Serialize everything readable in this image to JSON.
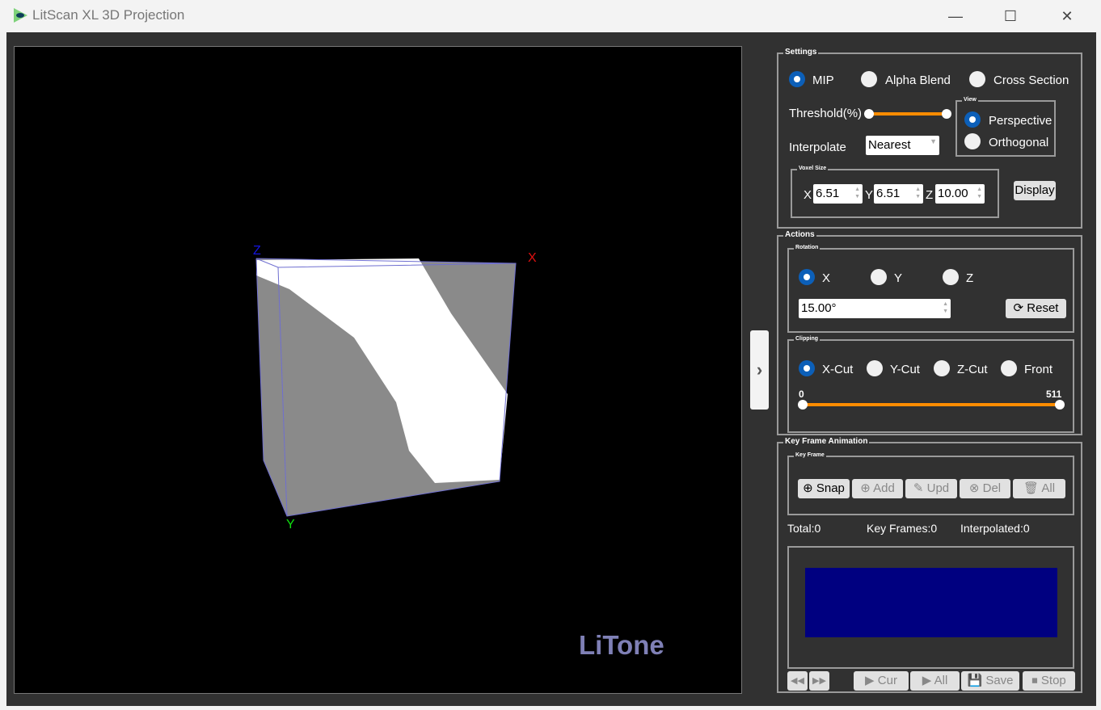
{
  "window": {
    "title": "LitScan XL 3D Projection",
    "minimize": "—",
    "maximize": "☐",
    "close": "✕"
  },
  "viewport": {
    "brand": "LiTone",
    "axes": {
      "x": "X",
      "y": "Y",
      "z": "Z"
    },
    "axis_colors": {
      "x": "#e01010",
      "y": "#10e010",
      "z": "#1010e0"
    }
  },
  "toggle_panel": "›",
  "settings": {
    "title": "Settings",
    "modes": [
      {
        "label": "MIP",
        "selected": true
      },
      {
        "label": "Alpha Blend",
        "selected": false
      },
      {
        "label": "Cross Section",
        "selected": false
      }
    ],
    "threshold_label": "Threshold(%)",
    "threshold_range": [
      0,
      100
    ],
    "interpolate_label": "Interpolate",
    "interpolate_value": "Nearest",
    "view": {
      "title": "View",
      "options": [
        {
          "label": "Perspective",
          "selected": true
        },
        {
          "label": "Orthogonal",
          "selected": false
        }
      ]
    },
    "voxel": {
      "title": "Voxel Size",
      "x_label": "X",
      "x": "6.51",
      "y_label": "Y",
      "y": "6.51",
      "z_label": "Z",
      "z": "10.00"
    },
    "display_button": "Display"
  },
  "actions": {
    "title": "Actions",
    "rotation": {
      "title": "Rotation",
      "axes": [
        {
          "label": "X",
          "selected": true
        },
        {
          "label": "Y",
          "selected": false
        },
        {
          "label": "Z",
          "selected": false
        }
      ],
      "angle": "15.00°",
      "reset": "Reset"
    },
    "clipping": {
      "title": "Clipping",
      "options": [
        {
          "label": "X-Cut",
          "selected": true
        },
        {
          "label": "Y-Cut",
          "selected": false
        },
        {
          "label": "Z-Cut",
          "selected": false
        },
        {
          "label": "Front",
          "selected": false
        }
      ],
      "min": "0",
      "max": "511"
    }
  },
  "keyframe": {
    "title": "Key Frame Animation",
    "sub_title": "Key Frame",
    "buttons": {
      "snap": "Snap",
      "add": "Add",
      "upd": "Upd",
      "del": "Del",
      "all": "All"
    },
    "total": "Total:0",
    "key_frames": "Key Frames:0",
    "interpolated": "Interpolated:0",
    "preview_color": "#000080",
    "playback": {
      "cur": "Cur",
      "all": "All",
      "save": "Save",
      "stop": "Stop"
    }
  }
}
